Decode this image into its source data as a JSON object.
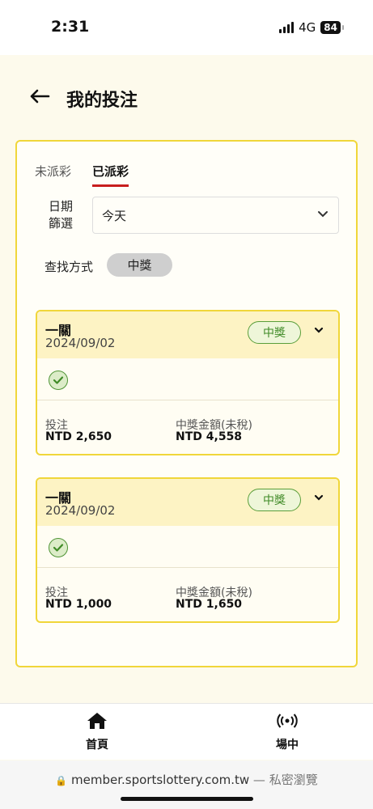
{
  "status_bar": {
    "time": "2:31",
    "network": "4G",
    "battery": "84"
  },
  "header": {
    "title": "我的投注"
  },
  "tabs": [
    {
      "label": "未派彩",
      "active": false
    },
    {
      "label": "已派彩",
      "active": true
    }
  ],
  "filters": {
    "date_label_line1": "日期",
    "date_label_line2": "篩選",
    "date_value": "今天",
    "search_label": "查找方式",
    "search_chip": "中獎"
  },
  "bets": [
    {
      "type": "一關",
      "date": "2024/09/02",
      "badge": "中獎",
      "stake_label": "投注",
      "stake_value": "NTD 2,650",
      "prize_label": "中獎金額(未稅)",
      "prize_value": "NTD 4,558"
    },
    {
      "type": "一關",
      "date": "2024/09/02",
      "badge": "中獎",
      "stake_label": "投注",
      "stake_value": "NTD 1,000",
      "prize_label": "中獎金額(未稅)",
      "prize_value": "NTD 1,650"
    }
  ],
  "bottom_nav": [
    {
      "label": "首頁",
      "icon": "home-icon"
    },
    {
      "label": "場中",
      "icon": "live-broadcast-icon"
    }
  ],
  "browser": {
    "url": "member.sportslottery.com.tw",
    "mode": "— 私密瀏覽"
  },
  "colors": {
    "accent_border": "#f0d63a",
    "tab_underline": "#c81e1e",
    "win_green": "#3f8a26"
  }
}
